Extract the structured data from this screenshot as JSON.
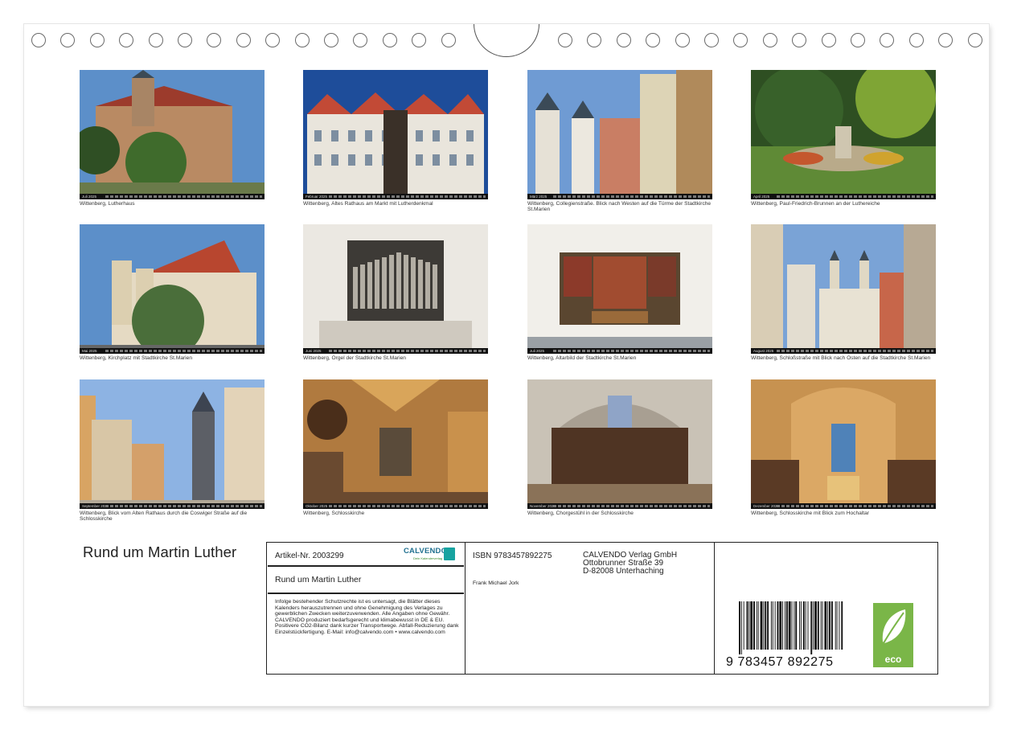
{
  "photos": [
    {
      "caption": "Wittenberg, Lutherhaus",
      "month": "Juli 2025",
      "scene": "lutherhaus"
    },
    {
      "caption": "Wittenberg, Altes Rathaus am Markt mit Lutherdenkmal",
      "month": "Februar 2025",
      "scene": "rathaus"
    },
    {
      "caption": "Wittenberg, Collegienstraße. Blick nach Westen auf die Türme der Stadtkirche St.Marien",
      "month": "März 2025",
      "scene": "collegienstrasse"
    },
    {
      "caption": "Wittenberg, Paul-Friedrich-Brunnen an der Luthereiche",
      "month": "April 2025",
      "scene": "brunnen"
    },
    {
      "caption": "Wittenberg, Kirchplatz mit Stadtkirche St.Marien",
      "month": "Mai 2025",
      "scene": "kirchplatz"
    },
    {
      "caption": "Wittenberg, Orgel der Stadtkirche St.Marien",
      "month": "Juni 2025",
      "scene": "orgel"
    },
    {
      "caption": "Wittenberg, Altarbild der Stadtkirche St.Marien",
      "month": "Juli 2025",
      "scene": "altarbild"
    },
    {
      "caption": "Wittenberg, Schloßstraße mit Blick nach Osten auf die Stadtkirche St.Marien",
      "month": "August 2025",
      "scene": "schlossstrasse"
    },
    {
      "caption": "Wittenberg, Blick vom Alten Rathaus durch die Coswiger Straße auf die Schlosskirche",
      "month": "September 2025",
      "scene": "coswiger"
    },
    {
      "caption": "Wittenberg, Schlosskirche",
      "month": "Oktober 2025",
      "scene": "schlosskirche"
    },
    {
      "caption": "Wittenberg, Chorgestühl in der Schlosskirche",
      "month": "November 2025",
      "scene": "chorgestuehl"
    },
    {
      "caption": "Wittenberg, Schlosskirche mit Blick zum Hochaltar",
      "month": "Dezember 2025",
      "scene": "hochaltar"
    }
  ],
  "back_cover": {
    "title": "Rund um Martin Luther",
    "article_no": "Artikel-Nr. 2003299",
    "box_title": "Rund um Martin Luther",
    "legal_text": "Infolge bestehender Schutzrechte ist es untersagt, die Blätter dieses Kalenders herauszutrennen und ohne Genehmigung des Verlages zu gewerblichen Zwecken weiterzuverwenden. Alle Angaben ohne Gewähr. CALVENDO produziert bedarfsgerecht und klimabewusst in DE & EU. Positivere CO2-Bilanz dank kurzer Transportwege. Abfall-Reduzierung dank Einzelstückfertigung. E-Mail: info@calvendo.com • www.calvendo.com",
    "isbn": "ISBN 9783457892275",
    "author": "Frank Michael Jork",
    "publisher_lines": [
      "CALVENDO Verlag GmbH",
      "Ottobrunner Straße 39",
      "D-82008 Unterhaching"
    ],
    "barcode_digits": "9 783457 892275",
    "logo_word": "CALVENDO",
    "logo_tagline": "Dein Kalenderverlag",
    "eco_label": "eco"
  },
  "colors": {
    "calvendo_blue": "#1f6f8f",
    "eco_green": "#7ab648"
  }
}
